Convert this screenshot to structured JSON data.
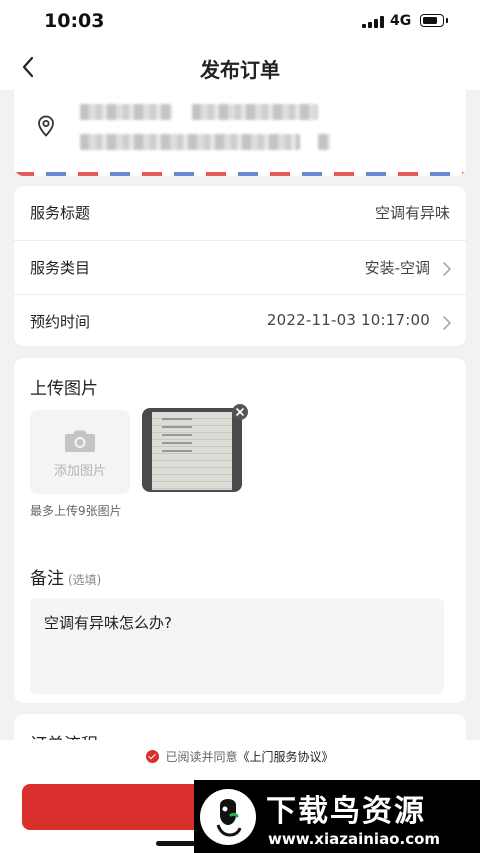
{
  "status": {
    "time": "10:03",
    "network": "4G",
    "battery_level": 0.85
  },
  "nav": {
    "title": "发布订单"
  },
  "service": {
    "rows": [
      {
        "label": "服务标题",
        "value": "空调有异味"
      },
      {
        "label": "服务类目",
        "value": "安装-空调"
      },
      {
        "label": "预约时间",
        "value": "2022-11-03 10:17:00"
      }
    ]
  },
  "upload": {
    "title": "上传图片",
    "add_label": "添加图片",
    "hint": "最多上传9张图片"
  },
  "note": {
    "title": "备注",
    "optional": "(选填)",
    "value": "空调有异味怎么办?"
  },
  "flow": {
    "title": "订单流程"
  },
  "agree": {
    "prefix": "已阅读并同意",
    "link": "《上门服务协议》"
  },
  "watermark": {
    "name": "下载鸟资源",
    "url": "www.xiazainiao.com"
  },
  "colors": {
    "accent": "#d9302d",
    "background": "#f2f2f2"
  },
  "icons": [
    "back-icon",
    "location-pin-icon",
    "chevron-right-icon",
    "camera-icon",
    "close-icon",
    "check-icon"
  ]
}
